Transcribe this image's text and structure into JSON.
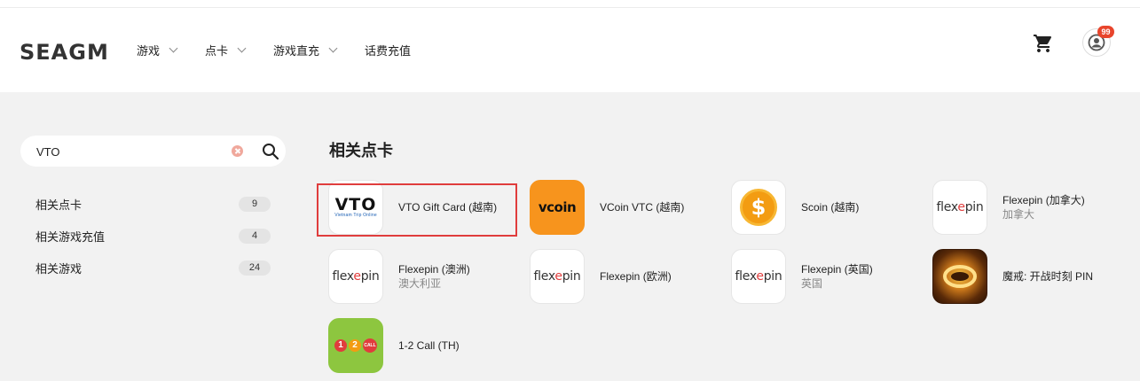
{
  "logo": "SEAGM",
  "nav": [
    {
      "label": "游戏",
      "has_dropdown": true
    },
    {
      "label": "点卡",
      "has_dropdown": true
    },
    {
      "label": "游戏直充",
      "has_dropdown": true
    },
    {
      "label": "话费充值",
      "has_dropdown": false
    }
  ],
  "header": {
    "badge_count": "99",
    "cart_icon": "cart-icon",
    "account_icon": "user-icon"
  },
  "search": {
    "value": "VTO",
    "clear_icon": "clear-icon",
    "search_icon": "search-icon"
  },
  "sidebar": [
    {
      "label": "相关点卡",
      "count": "9"
    },
    {
      "label": "相关游戏充值",
      "count": "4"
    },
    {
      "label": "相关游戏",
      "count": "24"
    }
  ],
  "section_title": "相关点卡",
  "cards": [
    {
      "name": "VTO Gift Card (越南)",
      "sub": "",
      "thumb_text": "VTO",
      "thumb_subtext": "Vietnam Trip Online",
      "selected": true
    },
    {
      "name": "VCoin VTC (越南)",
      "sub": "",
      "thumb_text": "vcoin"
    },
    {
      "name": "Scoin (越南)",
      "sub": "",
      "thumb_text": "$"
    },
    {
      "name": "Flexepin (加拿大)",
      "sub": "加拿大",
      "thumb_text": "flexepin"
    },
    {
      "name": "Flexepin (澳洲)",
      "sub": "澳大利亚",
      "thumb_text": "flexepin"
    },
    {
      "name": "Flexepin (欧洲)",
      "sub": "",
      "thumb_text": "flexepin"
    },
    {
      "name": "Flexepin (英国)",
      "sub": "英国",
      "thumb_text": "flexepin"
    },
    {
      "name": "魔戒: 开战时刻 PIN",
      "sub": ""
    },
    {
      "name": "1-2 Call (TH)",
      "sub": "",
      "thumb_text": "CALL"
    }
  ],
  "colors": {
    "accent": "#e03d3d",
    "vcoin_bg": "#f7941d",
    "scoin": "#f39c12",
    "call_bg": "#8dc63f",
    "badge": "#e8452c"
  }
}
